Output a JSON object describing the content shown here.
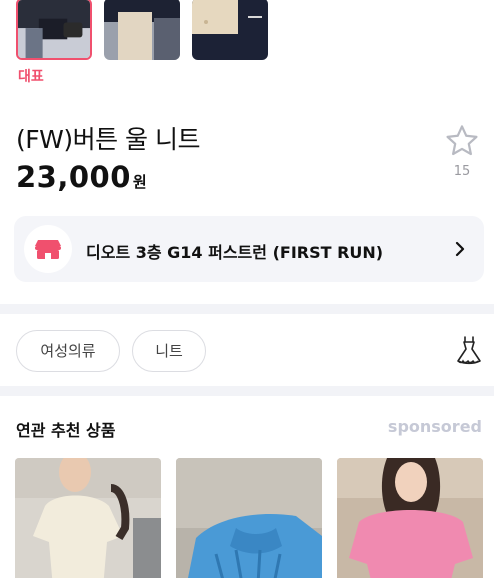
{
  "gallery": {
    "selected_label": "대표",
    "thumbnails": [
      "thumbnail-1",
      "thumbnail-2",
      "thumbnail-3"
    ]
  },
  "product": {
    "title": "(FW)버튼 울 니트",
    "price": "23,000",
    "price_unit": "원"
  },
  "favorite": {
    "icon": "star-outline-icon",
    "count": "15"
  },
  "shop": {
    "icon": "store-icon",
    "name": "디오트 3층 G14 퍼스트런 (FIRST RUN)",
    "chevron": "chevron-right-icon"
  },
  "tags": {
    "items": [
      "여성의류",
      "니트"
    ],
    "category_icon": "dress-icon"
  },
  "recommendations": {
    "title": "연관 추천 상품",
    "sponsored_label": "sponsored",
    "items": [
      "product-image-cream-knit",
      "product-image-blue-cable-knit",
      "product-image-pink-knit"
    ]
  },
  "colors": {
    "accent": "#f0506e",
    "card_bg": "#f4f5f9",
    "divider": "#f2f3f7",
    "muted": "#9a9aa0",
    "sponsored": "#c6c9d6"
  }
}
